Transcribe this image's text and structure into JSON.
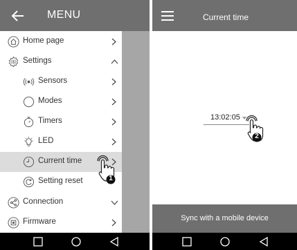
{
  "left_screen": {
    "menu_bar": {
      "title": "MENU",
      "back_icon": "arrow-left-icon"
    },
    "items": [
      {
        "label": "Home page",
        "icon": "home-icon",
        "chevron": "right",
        "level": 0
      },
      {
        "label": "Settings",
        "icon": "settings-sliders-icon",
        "chevron": "up",
        "level": 0
      },
      {
        "label": "Sensors",
        "icon": "sensor-icon",
        "chevron": "right",
        "level": 1
      },
      {
        "label": "Modes",
        "icon": "mode-circle-icon",
        "chevron": "right",
        "level": 1
      },
      {
        "label": "Timers",
        "icon": "timer-icon",
        "chevron": "right",
        "level": 1
      },
      {
        "label": "LED",
        "icon": "led-bulb-icon",
        "chevron": "right",
        "level": 1
      },
      {
        "label": "Current time",
        "icon": "clock-icon",
        "chevron": "right",
        "level": 1,
        "selected": true
      },
      {
        "label": "Setting reset",
        "icon": "reset-icon",
        "chevron": "",
        "level": 1
      },
      {
        "label": "Connection",
        "icon": "share-icon",
        "chevron": "down",
        "level": 0
      },
      {
        "label": "Firmware",
        "icon": "chip-icon",
        "chevron": "right",
        "level": 0
      }
    ],
    "tap_hint": {
      "number": "1",
      "icon": "tap-hand-icon"
    }
  },
  "right_screen": {
    "title_bar": {
      "title": "Current time",
      "menu_icon": "hamburger-icon"
    },
    "time_field": {
      "value": "13:02:05",
      "icon": "dropdown-caret-icon"
    },
    "tap_hint": {
      "number": "2",
      "icon": "tap-hand-icon"
    },
    "sync_button": {
      "label": "Sync with a mobile device"
    }
  },
  "navbar": {
    "icons": [
      "square-icon",
      "circle-icon",
      "triangle-back-icon"
    ]
  },
  "colors": {
    "bar_gray": "#6f6f6f",
    "selected_row": "#dcdcdc",
    "overlay_gray": "#a6a6a6",
    "nav_black": "#000000"
  }
}
